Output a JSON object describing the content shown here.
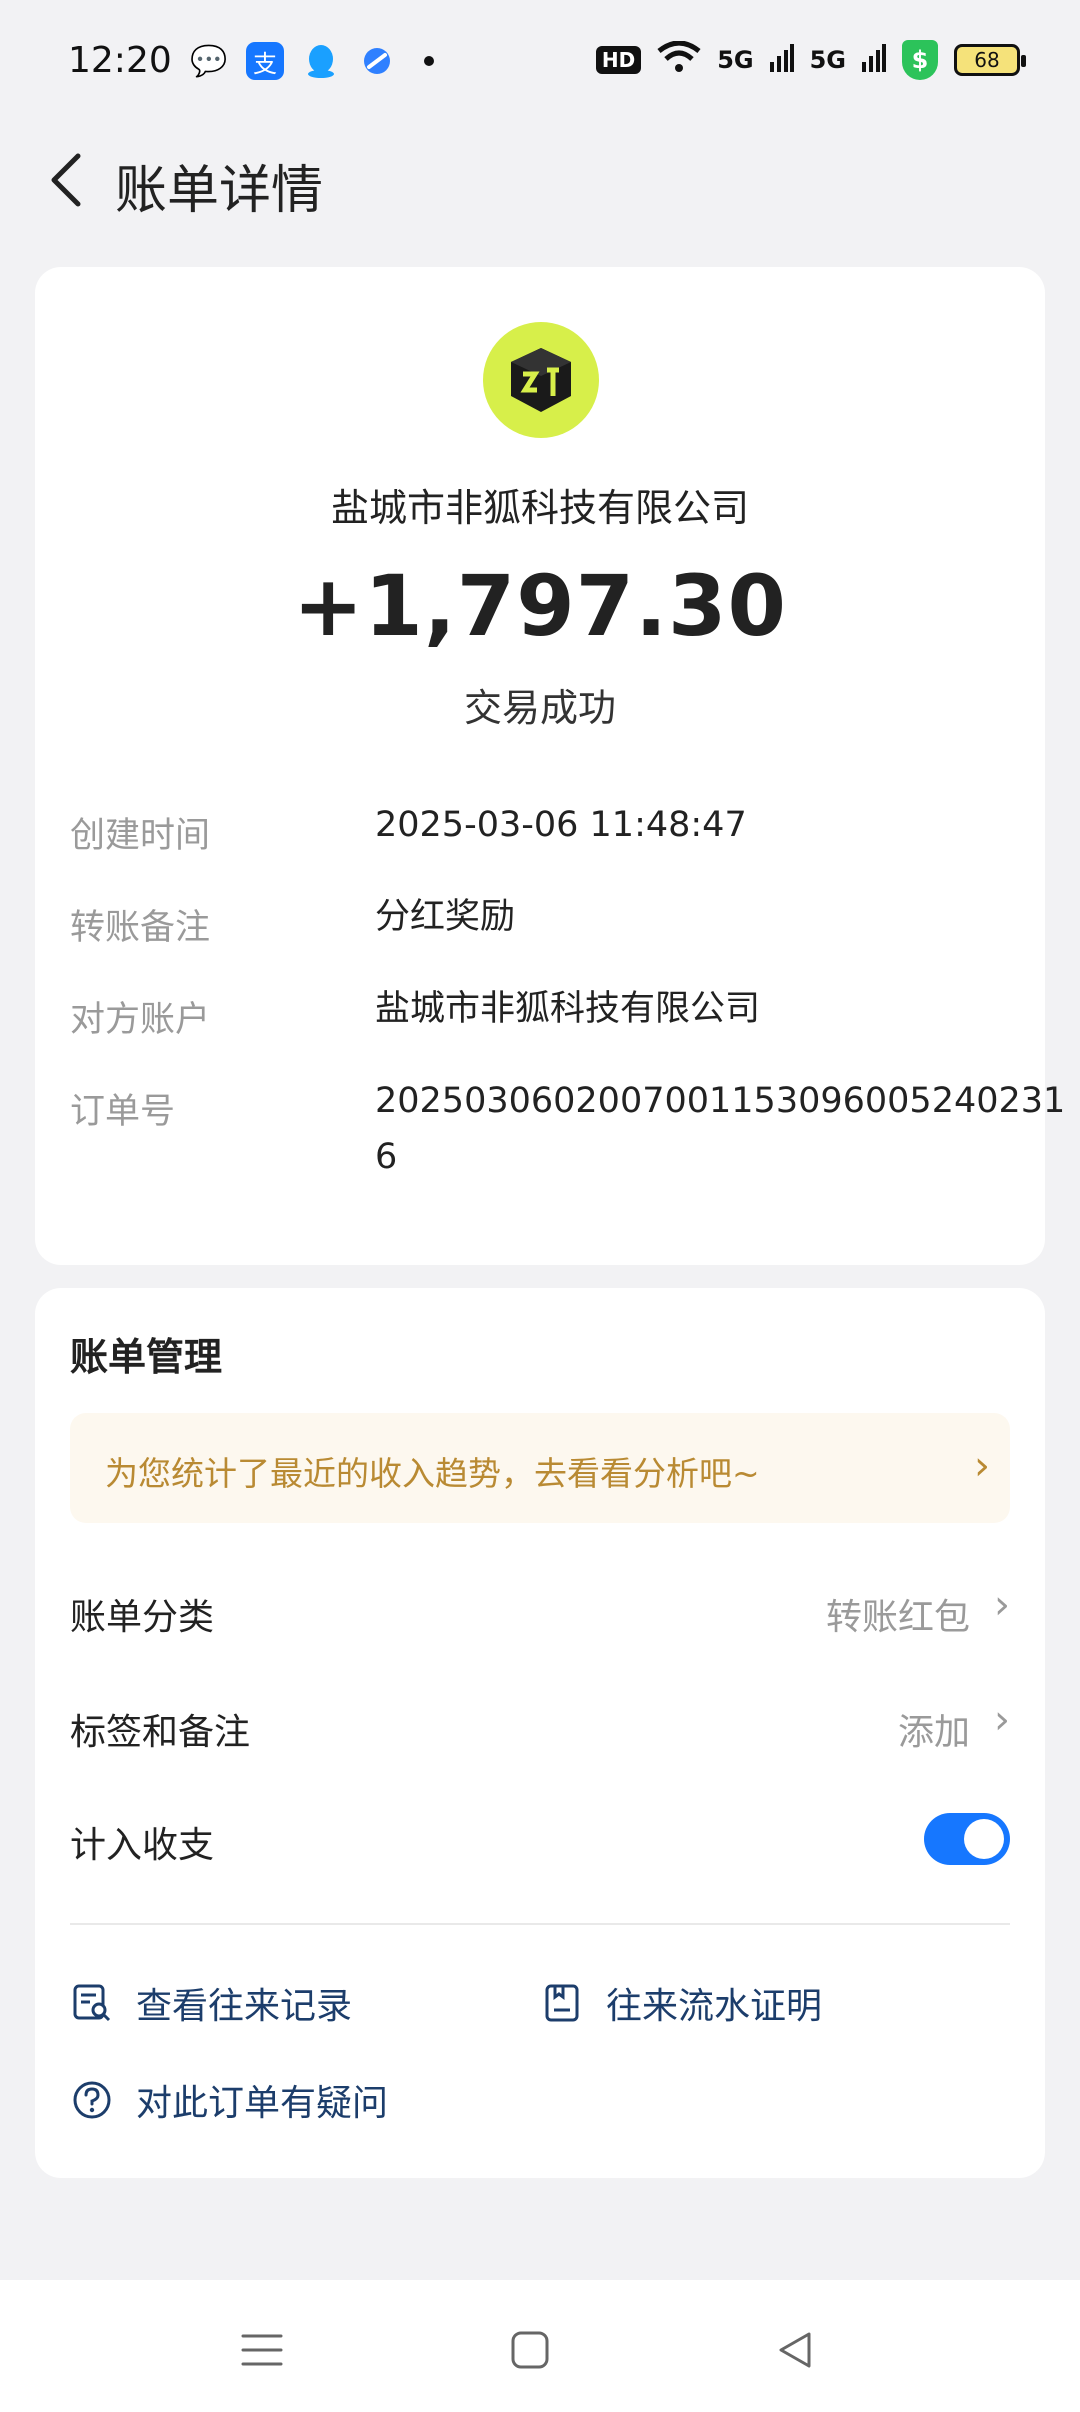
{
  "status_bar": {
    "time": "12:20",
    "apps": [
      "wechat-icon",
      "alipay-icon",
      "qq-icon",
      "browser-icon"
    ],
    "alipay_glyph": "支",
    "hd_label": "HD",
    "signal1_label": "5G",
    "signal2_label": "5G",
    "battery_level": "68",
    "shield_glyph": "$"
  },
  "header": {
    "title": "账单详情"
  },
  "transaction": {
    "merchant_name": "盐城市非狐科技有限公司",
    "amount": "+1,797.30",
    "status": "交易成功",
    "details": [
      {
        "label": "创建时间",
        "value": "2025-03-06 11:48:47"
      },
      {
        "label": "转账备注",
        "value": "分红奖励"
      },
      {
        "label": "对方账户",
        "value": "盐城市非狐科技有限公司"
      },
      {
        "label": "订单号",
        "value": "20250306020070011530960052402316"
      }
    ]
  },
  "manage": {
    "title": "账单管理",
    "promo_text": "为您统计了最近的收入趋势，去看看分析吧~",
    "category_label": "账单分类",
    "category_value": "转账红包",
    "tags_label": "标签和备注",
    "tags_value": "添加",
    "include_label": "计入收支",
    "include_enabled": true,
    "view_records": "查看往来记录",
    "flow_proof": "往来流水证明",
    "question": "对此订单有疑问"
  },
  "colors": {
    "accent": "#1677ff",
    "promo_text": "#b98a33",
    "promo_bg": "#fdf8ef",
    "link_text": "#1c3d6b",
    "logo_bg": "#d7ef4a"
  },
  "bottom_nav": [
    "menu-icon",
    "home-icon",
    "back-triangle-icon"
  ]
}
